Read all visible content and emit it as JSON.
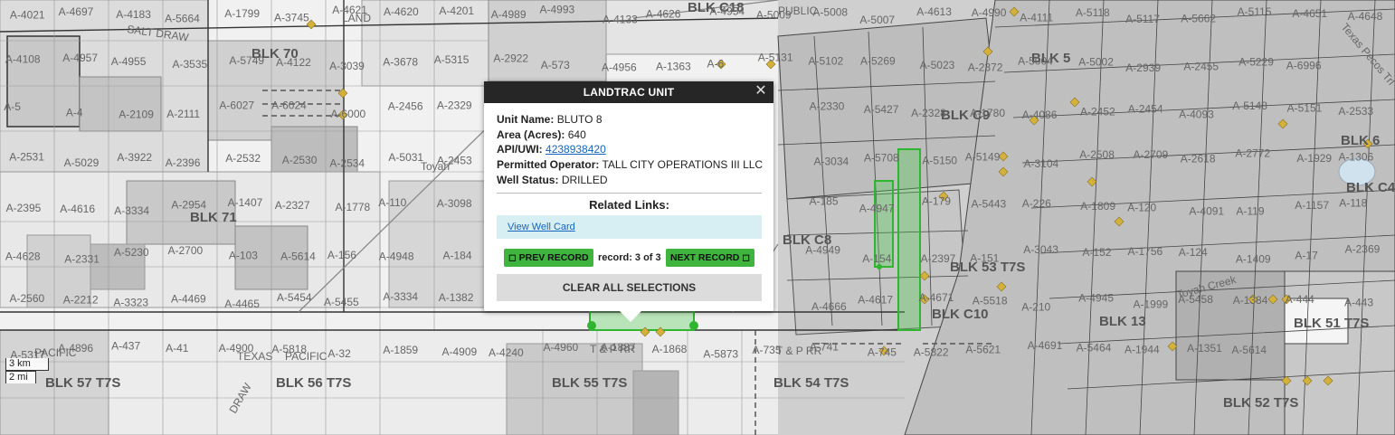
{
  "popup": {
    "title": "LANDTRAC UNIT",
    "close_glyph": "✕",
    "fields": [
      {
        "label": "Unit Name:",
        "value": "BLUTO 8"
      },
      {
        "label": "Area (Acres):",
        "value": "640"
      },
      {
        "label": "API/UWI:",
        "value": "4238938420",
        "is_link": true
      },
      {
        "label": "Permitted Operator:",
        "value": "TALL CITY OPERATIONS III LLC"
      },
      {
        "label": "Well Status:",
        "value": "DRILLED"
      }
    ],
    "related_links_title": "Related Links:",
    "related_link": "View Well Card",
    "prev_button": "◻ PREV RECORD",
    "record_text": "record: 3 of 3",
    "next_button": "NEXT RECORD ◻",
    "clear_button": "CLEAR ALL SELECTIONS"
  },
  "scale": {
    "km": "3 km",
    "mi": "2 mi"
  },
  "map": {
    "blocks": [
      "BLK 70",
      "BLK 71",
      "BLK 56 T7S",
      "BLK 55 T7S",
      "BLK 54 T7S",
      "BLK 53 T7S",
      "BLK 51 T7S",
      "BLK 52 T7S",
      "BLK 5",
      "BLK 6",
      "BLK C9",
      "BLK C8",
      "BLK C10",
      "BLK 13",
      "BLK C4",
      "BLK C18",
      "BLK 57 T7S"
    ],
    "places": [
      "Toyah",
      "SALT DRAW",
      "LAND",
      "PACIFIC",
      "TEXAS",
      "PACIFIC",
      "T & P RR",
      "T & P RR",
      "PUBLIC",
      "DRAW",
      "Toyah Creek",
      "Texas Pecos Trl"
    ],
    "abstracts": [
      "A-4021",
      "A-4697",
      "A-4183",
      "A-5664",
      "A-1799",
      "A-3745",
      "A-4621",
      "A-4620",
      "A-4201",
      "A-4989",
      "A-4993",
      "A-4133",
      "A-4626",
      "A-4954",
      "A-5009",
      "A-5008",
      "A-5007",
      "A-4613",
      "A-4990",
      "A-4111",
      "A-5118",
      "A-5117",
      "A-5662",
      "A-5115",
      "A-4651",
      "A-4648",
      "A-4108",
      "A-4957",
      "A-4955",
      "A-3535",
      "A-5749",
      "A-4122",
      "A-3039",
      "A-3678",
      "A-5315",
      "A-2922",
      "A-573",
      "A-4956",
      "A-1363",
      "A-6",
      "A-5131",
      "A-5102",
      "A-5269",
      "A-5023",
      "A-2372",
      "A-5004",
      "A-5002",
      "A-2939",
      "A-2455",
      "A-5229",
      "A-6996",
      "A-5",
      "A-4",
      "A-2109",
      "A-2111",
      "A-6027",
      "A-6024",
      "A-6000",
      "A-2456",
      "A-2329",
      "A-2330",
      "A-5427",
      "A-2328",
      "A-1780",
      "A-4086",
      "A-2452",
      "A-2454",
      "A-4093",
      "A-5148",
      "A-5151",
      "A-2533",
      "A-2531",
      "A-5029",
      "A-3922",
      "A-2396",
      "A-2532",
      "A-2530",
      "A-2534",
      "A-5031",
      "A-2453",
      "A-3034",
      "A-5708",
      "A-5150",
      "A-5149",
      "A-3104",
      "A-2508",
      "A-2709",
      "A-2618",
      "A-2772",
      "A-1929",
      "A-1306",
      "A-2395",
      "A-4616",
      "A-3334",
      "A-2954",
      "A-1407",
      "A-2327",
      "A-1778",
      "A-110",
      "A-3098",
      "A-185",
      "A-4947",
      "A-179",
      "A-5443",
      "A-226",
      "A-1809",
      "A-120",
      "A-4091",
      "A-119",
      "A-1157",
      "A-118",
      "A-4628",
      "A-2331",
      "A-5230",
      "A-2700",
      "A-103",
      "A-5614",
      "A-156",
      "A-4948",
      "A-184",
      "A-4949",
      "A-154",
      "A-2397",
      "A-151",
      "A-3043",
      "A-152",
      "A-1756",
      "A-124",
      "A-1409",
      "A-17",
      "A-2369",
      "A-2560",
      "A-2212",
      "A-3323",
      "A-4469",
      "A-4465",
      "A-5454",
      "A-5455",
      "A-3334",
      "A-1382",
      "A-4666",
      "A-4617",
      "A-4671",
      "A-5518",
      "A-210",
      "A-4945",
      "A-1999",
      "A-5458",
      "A-1384",
      "A-444",
      "A-443",
      "A-5317",
      "A-4896",
      "A-437",
      "A-41",
      "A-4900",
      "A-5818",
      "A-32",
      "A-1859",
      "A-4909",
      "A-4240",
      "A-4960",
      "A-1887",
      "A-1868",
      "A-5873",
      "A-735",
      "A-741",
      "A-745",
      "A-5822",
      "A-5621",
      "A-4691",
      "A-5464",
      "A-1944",
      "A-1351",
      "A-5614"
    ]
  }
}
